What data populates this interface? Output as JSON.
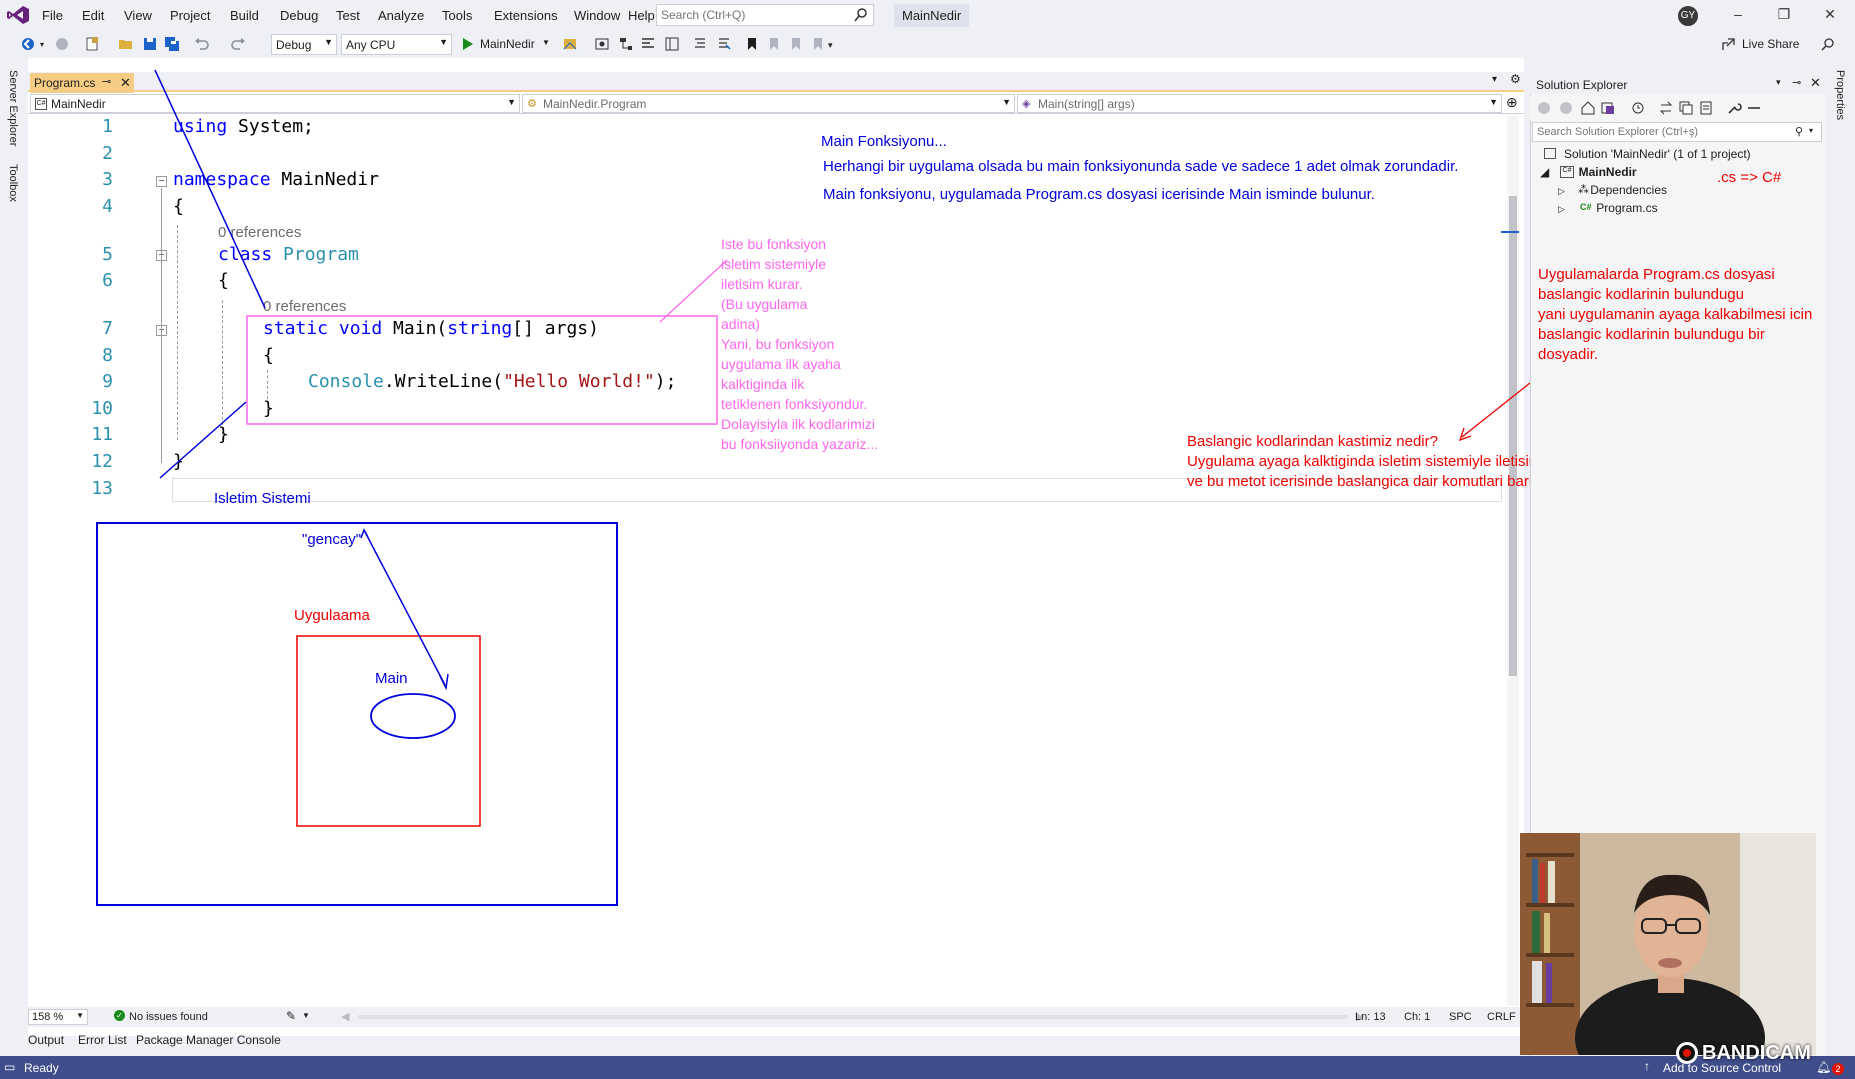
{
  "menu": {
    "items": [
      "File",
      "Edit",
      "View",
      "Project",
      "Build",
      "Debug",
      "Test",
      "Analyze",
      "Tools",
      "Extensions",
      "Window",
      "Help"
    ],
    "search_placeholder": "Search (Ctrl+Q)",
    "solution_name": "MainNedir",
    "user_initials": "GY"
  },
  "toolbar": {
    "config": "Debug",
    "platform": "Any CPU",
    "run_target": "MainNedir",
    "live_share": "Live Share"
  },
  "rails": {
    "left": [
      "Server Explorer",
      "Toolbox"
    ],
    "right": [
      "Properties"
    ]
  },
  "editor": {
    "tab_title": "Program.cs",
    "nav_project": "MainNedir",
    "nav_class": "MainNedir.Program",
    "nav_member": "Main(string[] args)",
    "line_numbers": [
      "1",
      "2",
      "3",
      "4",
      "5",
      "6",
      "7",
      "8",
      "9",
      "10",
      "11",
      "12",
      "13"
    ],
    "code": {
      "l1_kw": "using",
      "l1_rest": " System;",
      "l3_kw": "namespace",
      "l3_rest": " MainNedir",
      "l4": "{",
      "ref_class": "0 references",
      "l5_kw": "class",
      "l5_type": " Program",
      "l6": "{",
      "ref_main": "0 references",
      "l7_kw1": "static",
      "l7_kw2": " void",
      "l7_name": " Main(",
      "l7_kw3": "string",
      "l7_rest": "[] args)",
      "l8": "{",
      "l9_type": "Console",
      "l9_mid": ".WriteLine(",
      "l9_str": "\"Hello World!\"",
      "l9_end": ");",
      "l10": "}",
      "l11": "}",
      "l12": "}"
    },
    "zoom": "158 %",
    "issues": "No issues found",
    "position_ln": "Ln: 13",
    "position_ch": "Ch: 1",
    "encoding_spc": "SPC",
    "encoding_crlf": "CRLF"
  },
  "bottom_tabs": [
    "Output",
    "Error List",
    "Package Manager Console"
  ],
  "status": {
    "ready": "Ready",
    "source_control": "Add to Source Control",
    "notifications": "2"
  },
  "solution_explorer": {
    "title": "Solution Explorer",
    "search_placeholder": "Search Solution Explorer (Ctrl+ş)",
    "solution_label": "Solution 'MainNedir' (1 of 1 project)",
    "project": "MainNedir",
    "dependencies": "Dependencies",
    "file": "Program.cs"
  },
  "annotations": {
    "main_title": "Main Fonksiyonu...",
    "main_line1": "Herhangi bir uygulama olsada bu main fonksiyonunda sade ve sadece 1 adet olmak zorundadir.",
    "main_line2": "Main fonksiyonu, uygulamada Program.cs dosyasi icerisinde Main isminde bulunur.",
    "pink_lines": [
      "Iste bu fonksiyon",
      "isletim sistemiyle",
      "iletisim kurar.",
      "(Bu uygulama",
      "adina)",
      "Yani, bu fonksiyon",
      "uygulama ilk ayaha",
      "kalktiginda ilk",
      "tetiklenen fonksiyondur.",
      "Dolayisiyla ilk kodlarimizi",
      "bu fonksiiyonda yazariz..."
    ],
    "cs_note": ".cs => C#",
    "red_lines": [
      "Uygulamalarda Program.cs dosyasi",
      "baslangic kodlarinin bulundugu",
      "yani uygulamanin ayaga kalkabilmesi icin",
      "baslangic kodlarinin bulundugu bir",
      "dosyadir."
    ],
    "red_question": [
      "Baslangic kodlarindan kastimiz nedir?",
      "Uygulama ayaga kalktiginda isletim sistemiyle iletisim kurabilecek metodun",
      "ve bu metot icerisinde baslangica dair komutlari barindiracak bir insa.."
    ],
    "os_label": "Isletim Sistemi",
    "user_label": "\"gencay\"",
    "app_label": "Uygulaama",
    "main_label": "Main"
  },
  "watermark": "BANDICAM",
  "colors": {
    "accent": "#68217a",
    "status_bar": "#3f4e8b",
    "tab_active": "#f5cc84",
    "annotation_blue": "#0000dd",
    "annotation_red": "#ee0000",
    "annotation_pink": "#ff66ee"
  }
}
